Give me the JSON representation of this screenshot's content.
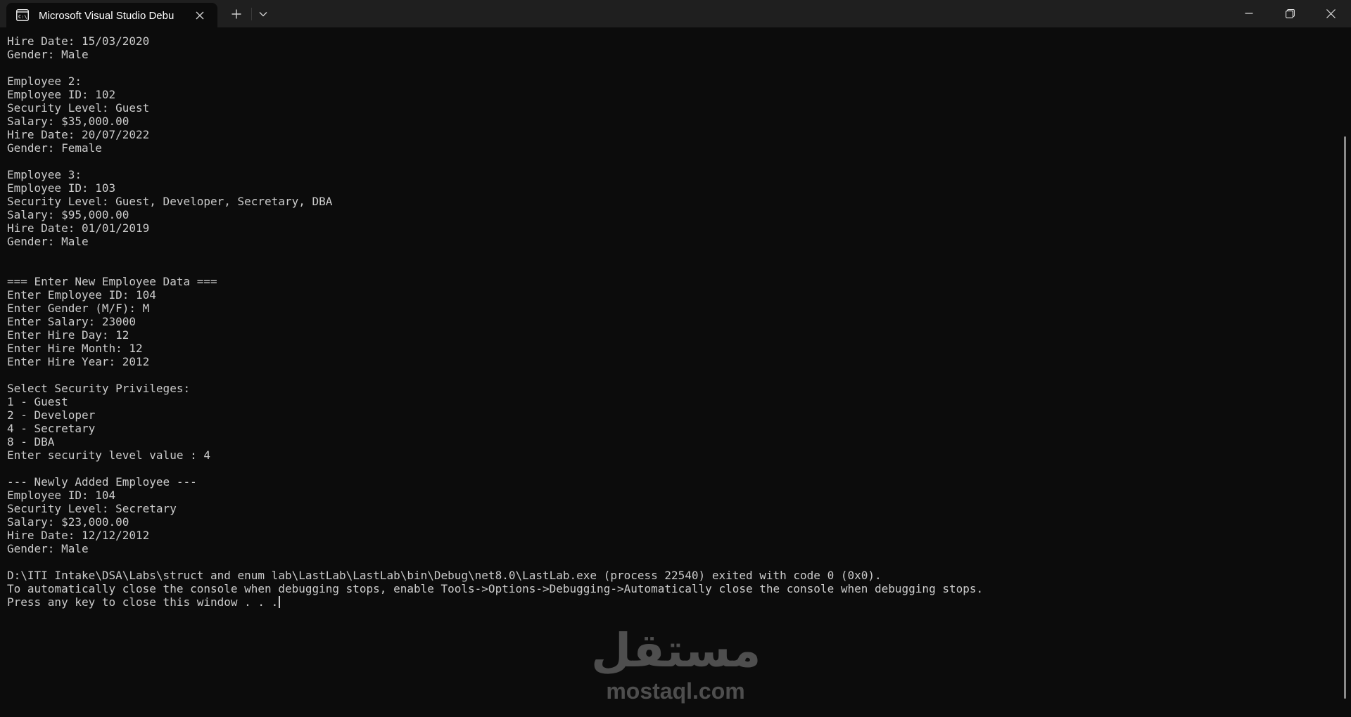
{
  "window": {
    "tab_title": "Microsoft Visual Studio Debu",
    "tab_icon": "console-app-icon",
    "controls": [
      "minimize-icon",
      "maximize-icon",
      "close-icon"
    ]
  },
  "console": {
    "lines": [
      "Hire Date: 15/03/2020",
      "Gender: Male",
      "",
      "Employee 2:",
      "Employee ID: 102",
      "Security Level: Guest",
      "Salary: $35,000.00",
      "Hire Date: 20/07/2022",
      "Gender: Female",
      "",
      "Employee 3:",
      "Employee ID: 103",
      "Security Level: Guest, Developer, Secretary, DBA",
      "Salary: $95,000.00",
      "Hire Date: 01/01/2019",
      "Gender: Male",
      "",
      "",
      "=== Enter New Employee Data ===",
      "Enter Employee ID: 104",
      "Enter Gender (M/F): M",
      "Enter Salary: 23000",
      "Enter Hire Day: 12",
      "Enter Hire Month: 12",
      "Enter Hire Year: 2012",
      "",
      "Select Security Privileges:",
      "1 - Guest",
      "2 - Developer",
      "4 - Secretary",
      "8 - DBA",
      "Enter security level value : 4",
      "",
      "--- Newly Added Employee ---",
      "Employee ID: 104",
      "Security Level: Secretary",
      "Salary: $23,000.00",
      "Hire Date: 12/12/2012",
      "Gender: Male",
      "",
      "D:\\ITI Intake\\DSA\\Labs\\struct and enum lab\\LastLab\\LastLab\\bin\\Debug\\net8.0\\LastLab.exe (process 22540) exited with code 0 (0x0).",
      "To automatically close the console when debugging stops, enable Tools->Options->Debugging->Automatically close the console when debugging stops.",
      "Press any key to close this window . . ."
    ]
  },
  "watermark": {
    "arabic": "مستقل",
    "latin": "mostaql.com"
  },
  "colors": {
    "background": "#0c0c0c",
    "titlebar": "#1f1f1f",
    "text": "#cccccc"
  }
}
